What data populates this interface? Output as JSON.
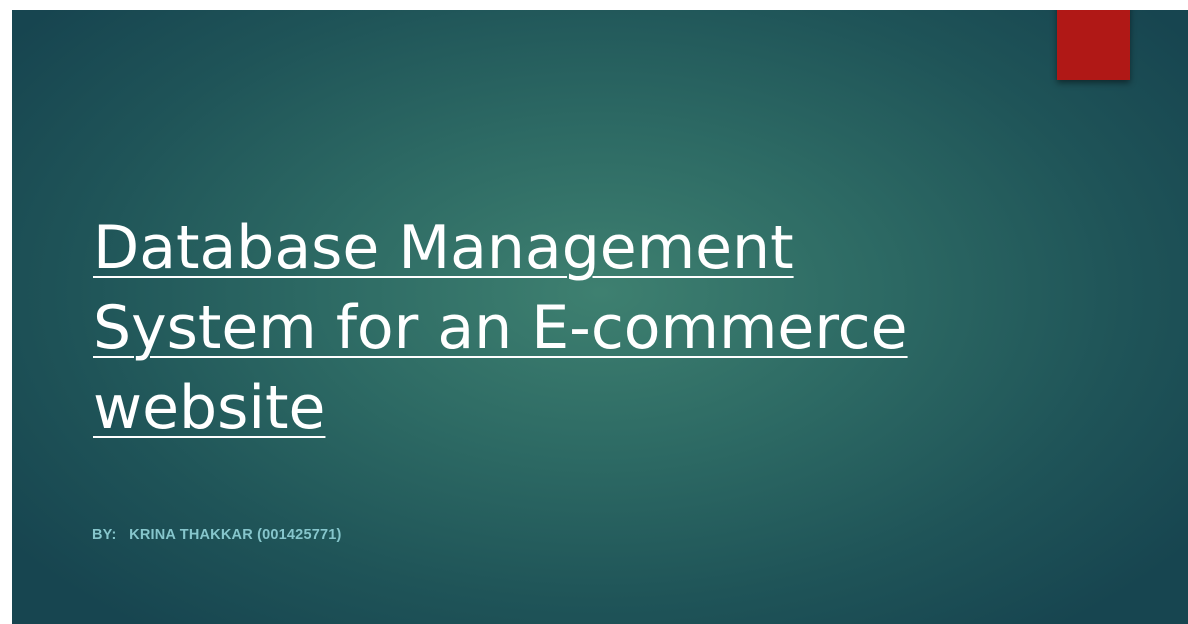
{
  "slide": {
    "title": "Database Management System for an E-commerce website",
    "byline": "BY:   KRINA THAKKAR (001425771)"
  },
  "colors": {
    "background_center": "#3e8070",
    "background_edge": "#174550",
    "accent_block": "#b01816",
    "title_text": "#ffffff",
    "byline_text": "#86c6cc"
  }
}
